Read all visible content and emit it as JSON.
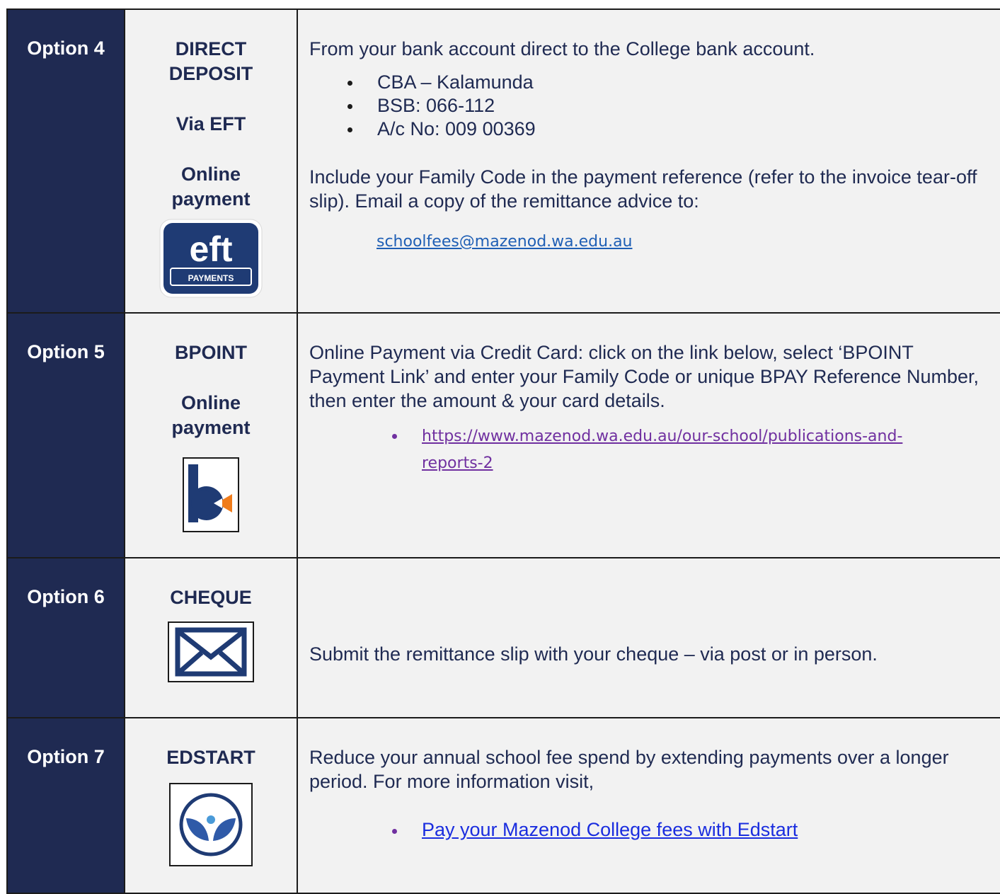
{
  "rows": [
    {
      "option": "Option 4",
      "method_lines": [
        "DIRECT",
        "DEPOSIT",
        "Via EFT",
        "Online",
        "payment"
      ],
      "icon": "eft-payments-icon",
      "icon_text": {
        "main": "eft",
        "sub": "PAYMENTS"
      },
      "intro": "From your bank account direct to the College bank account.",
      "bank_details": [
        "CBA – Kalamunda",
        "BSB: 066-112",
        "A/c No: 009 00369"
      ],
      "instructions": "Include your Family Code in the payment reference (refer to the invoice tear-off slip). Email a copy of the remittance advice to:",
      "email": "schoolfees@mazenod.wa.edu.au"
    },
    {
      "option": "Option 5",
      "method_lines": [
        "BPOINT",
        "Online",
        "payment"
      ],
      "icon": "bpoint-icon",
      "text": "Online Payment via Credit Card: click on the link below, select ‘BPOINT Payment Link’ and enter your Family Code or unique BPAY Reference Number, then enter the amount & your card details.",
      "link_line1": "https://www.mazenod.wa.edu.au/our-school/publications-and-",
      "link_line2": "reports-2"
    },
    {
      "option": "Option 6",
      "method_lines": [
        "CHEQUE"
      ],
      "icon": "envelope-icon",
      "text": "Submit the remittance slip with your cheque – via post or in person."
    },
    {
      "option": "Option 7",
      "method_lines": [
        "EDSTART"
      ],
      "icon": "edstart-leaf-icon",
      "text": "Reduce your annual school fee spend by extending payments over a longer period. For more information visit,",
      "link": "Pay your Mazenod College fees with Edstart"
    }
  ],
  "colors": {
    "option_bg": "#1f2a52",
    "cell_bg": "#f2f2f2",
    "text": "#1f2a52",
    "email_link": "#1f5fb5",
    "visited_link": "#7030a0",
    "edstart_link": "#1a2ddf",
    "bpoint_orange": "#f07c1b"
  }
}
